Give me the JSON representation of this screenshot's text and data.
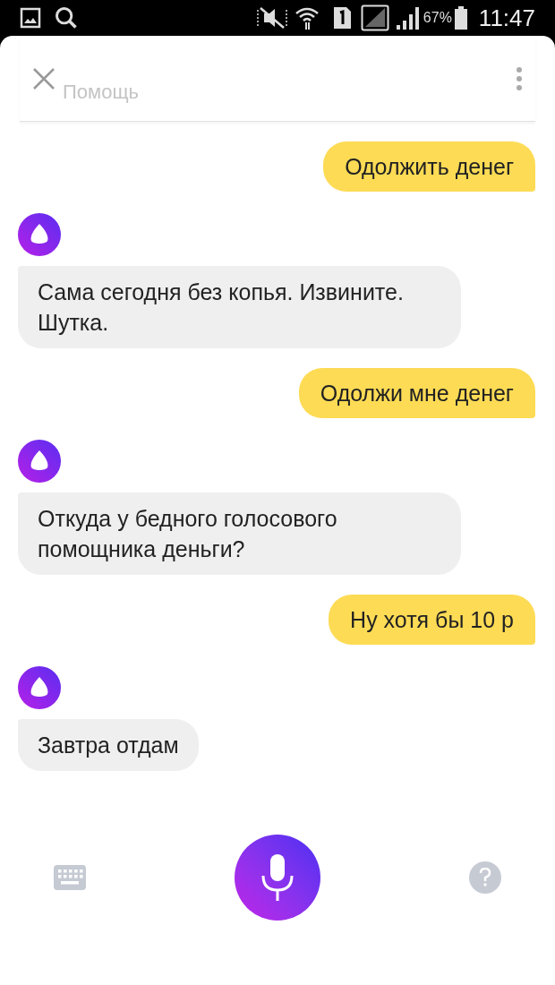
{
  "status_bar": {
    "battery": "67%",
    "time": "11:47"
  },
  "header": {
    "faded_title": "Помощь"
  },
  "messages": [
    {
      "kind": "user",
      "text": "Одолжить денег"
    },
    {
      "kind": "assistant",
      "text": "Сама сегодня без копья. Извините. Шутка."
    },
    {
      "kind": "user",
      "text": "Одолжи мне денег"
    },
    {
      "kind": "assistant",
      "text": "Откуда у бедного голосового помощника деньги?"
    },
    {
      "kind": "user",
      "text": "Ну хотя бы 10 р"
    },
    {
      "kind": "assistant",
      "text": "Завтра отдам"
    }
  ]
}
